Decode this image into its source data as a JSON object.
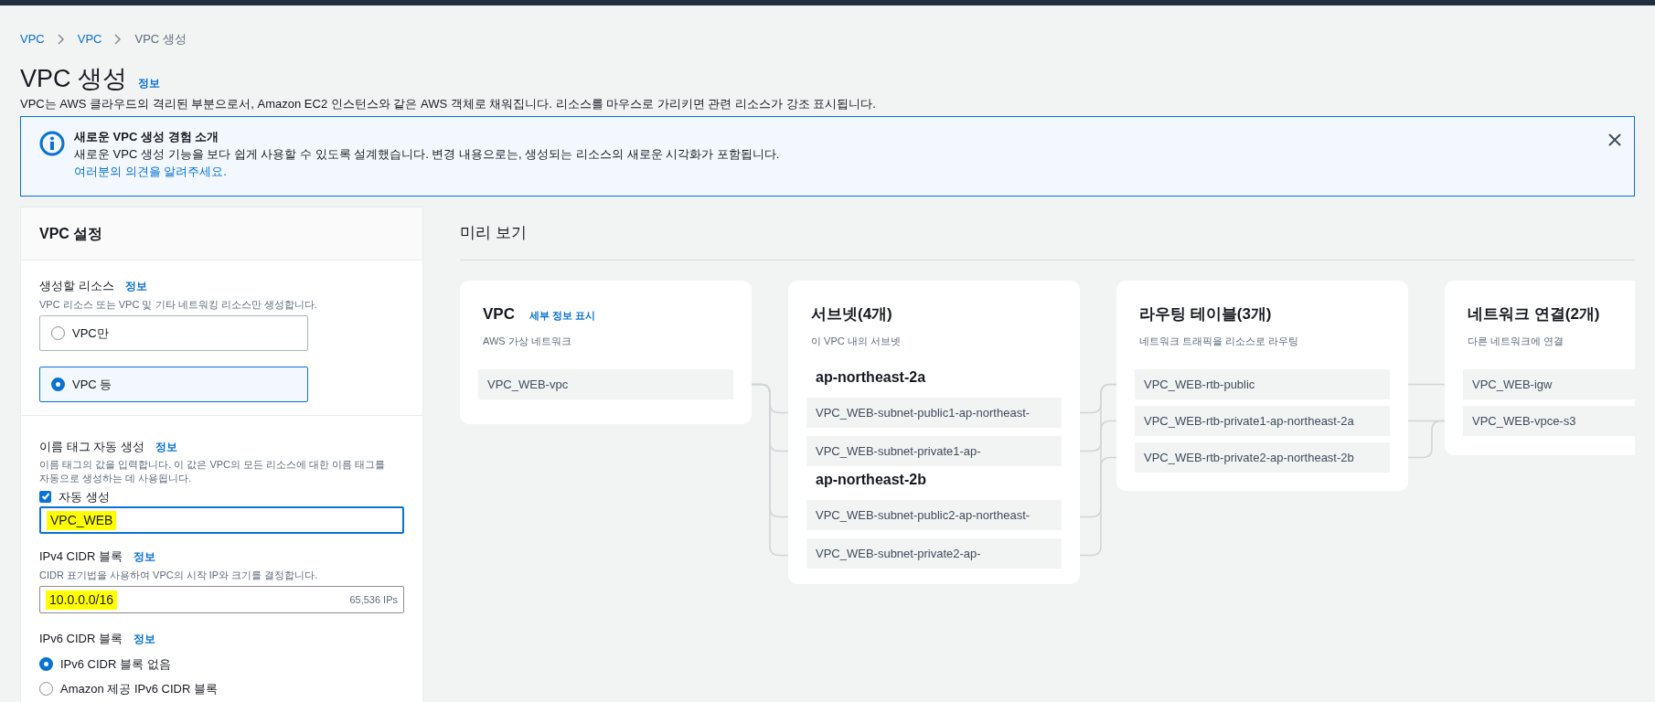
{
  "breadcrumbs": [
    {
      "label": "VPC",
      "link": true
    },
    {
      "label": "VPC",
      "link": true
    },
    {
      "label": "VPC 생성",
      "link": false
    }
  ],
  "page": {
    "title": "VPC 생성",
    "info": "정보",
    "description": "VPC는 AWS 클라우드의 격리된 부분으로서, Amazon EC2 인스턴스와 같은 AWS 객체로 채워집니다. 리소스를 마우스로 가리키면 관련 리소스가 강조 표시됩니다."
  },
  "alert": {
    "title": "새로운 VPC 생성 경험 소개",
    "body": "새로운 VPC 생성 기능을 보다 쉽게 사용할 수 있도록 설계했습니다. 변경 내용으로는, 생성되는 리소스의 새로운 시각화가 포함됩니다.",
    "link": "여러분의 의견을 알려주세요."
  },
  "settings": {
    "title": "VPC 설정",
    "resources": {
      "label": "생성할 리소스",
      "info": "정보",
      "description": "VPC 리소스 또는 VPC 및 기타 네트워킹 리소스만 생성합니다.",
      "options": [
        {
          "label": "VPC만",
          "selected": false
        },
        {
          "label": "VPC 등",
          "selected": true
        }
      ]
    },
    "name_tag": {
      "label": "이름 태그 자동 생성",
      "info": "정보",
      "description": "이름 태그의 값을 입력합니다. 이 값은 VPC의 모든 리소스에 대한 이름 태그를 자동으로 생성하는 데 사용됩니다.",
      "checkbox": {
        "label": "자동 생성",
        "checked": true
      },
      "value": "VPC_WEB",
      "highlighted": true
    },
    "ipv4": {
      "label": "IPv4 CIDR 블록",
      "info": "정보",
      "description": "CIDR 표기법을 사용하여 VPC의 시작 IP와 크기를 결정합니다.",
      "value": "10.0.0.0/16",
      "highlighted": true,
      "hint": "65,536 IPs"
    },
    "ipv6": {
      "label": "IPv6 CIDR 블록",
      "info": "정보",
      "options": [
        {
          "label": "IPv6 CIDR 블록 없음",
          "selected": true
        },
        {
          "label": "Amazon 제공 IPv6 CIDR 블록",
          "selected": false
        }
      ]
    }
  },
  "preview": {
    "title": "미리 보기",
    "cards": [
      {
        "title": "VPC",
        "link": "세부 정보 표시",
        "subtitle": "AWS 가상 네트워크",
        "groups": [
          {
            "items": [
              "VPC_WEB-vpc"
            ]
          }
        ]
      },
      {
        "title": "서브넷(4개)",
        "subtitle": "이 VPC 내의 서브넷",
        "groups": [
          {
            "heading": "ap-northeast-2a",
            "items": [
              "VPC_WEB-subnet-public1-ap-northeast-",
              "VPC_WEB-subnet-private1-ap-"
            ]
          },
          {
            "heading": "ap-northeast-2b",
            "items": [
              "VPC_WEB-subnet-public2-ap-northeast-",
              "VPC_WEB-subnet-private2-ap-"
            ]
          }
        ]
      },
      {
        "title": "라우팅 테이블(3개)",
        "subtitle": "네트워크 트래픽을 리소스로 라우팅",
        "groups": [
          {
            "items": [
              "VPC_WEB-rtb-public",
              "VPC_WEB-rtb-private1-ap-northeast-2a",
              "VPC_WEB-rtb-private2-ap-northeast-2b"
            ]
          }
        ]
      },
      {
        "title": "네트워크 연결(2개)",
        "subtitle": "다른 네트워크에 연결",
        "groups": [
          {
            "items": [
              "VPC_WEB-igw",
              "VPC_WEB-vpce-s3"
            ]
          }
        ]
      }
    ]
  }
}
